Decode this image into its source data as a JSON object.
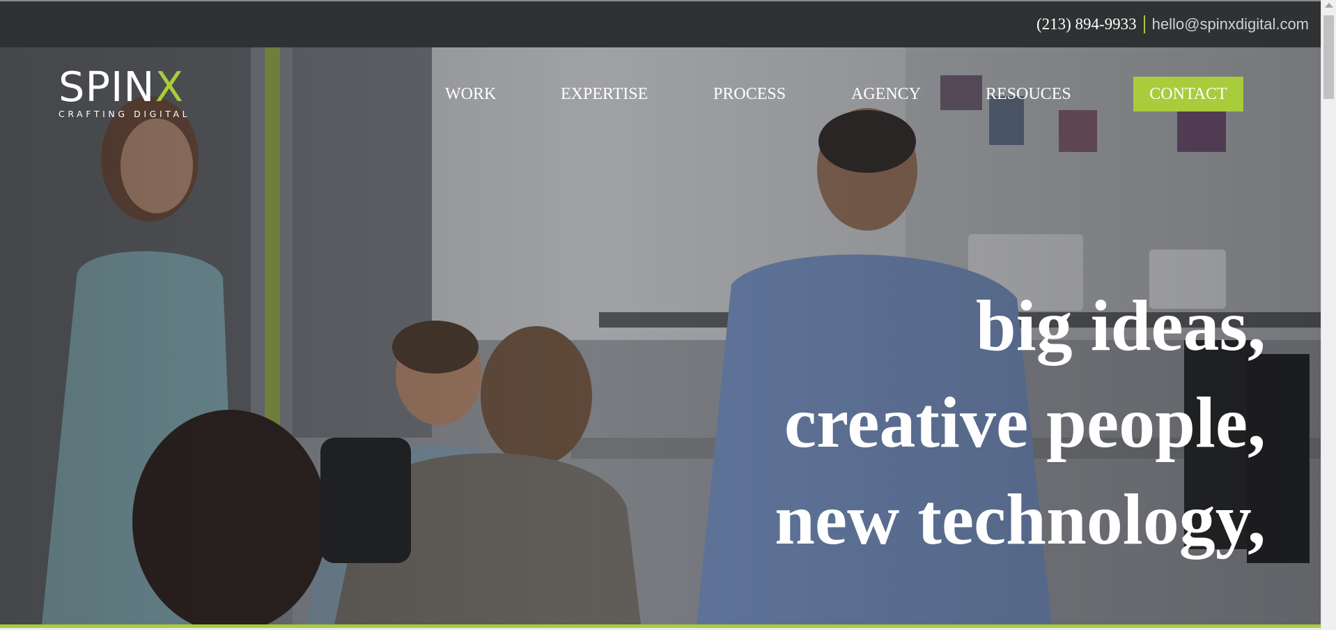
{
  "topbar": {
    "phone": "(213) 894-9933",
    "email": "hello@spinxdigital.com"
  },
  "logo": {
    "word_main": "SPIN",
    "word_accent": "X",
    "tagline": "CRAFTING DIGITAL"
  },
  "nav": {
    "items": [
      "WORK",
      "EXPERTISE",
      "PROCESS",
      "AGENCY",
      "RESOUCES"
    ],
    "cta": "CONTACT"
  },
  "hero": {
    "headline_lines": [
      "big ideas,",
      "creative people,",
      "new technology,"
    ]
  },
  "colors": {
    "accent": "#a8cc3b",
    "topbar": "#2f3133",
    "text": "#ffffff"
  },
  "icons": {
    "scroll_up": "scroll-up-arrow-icon"
  }
}
